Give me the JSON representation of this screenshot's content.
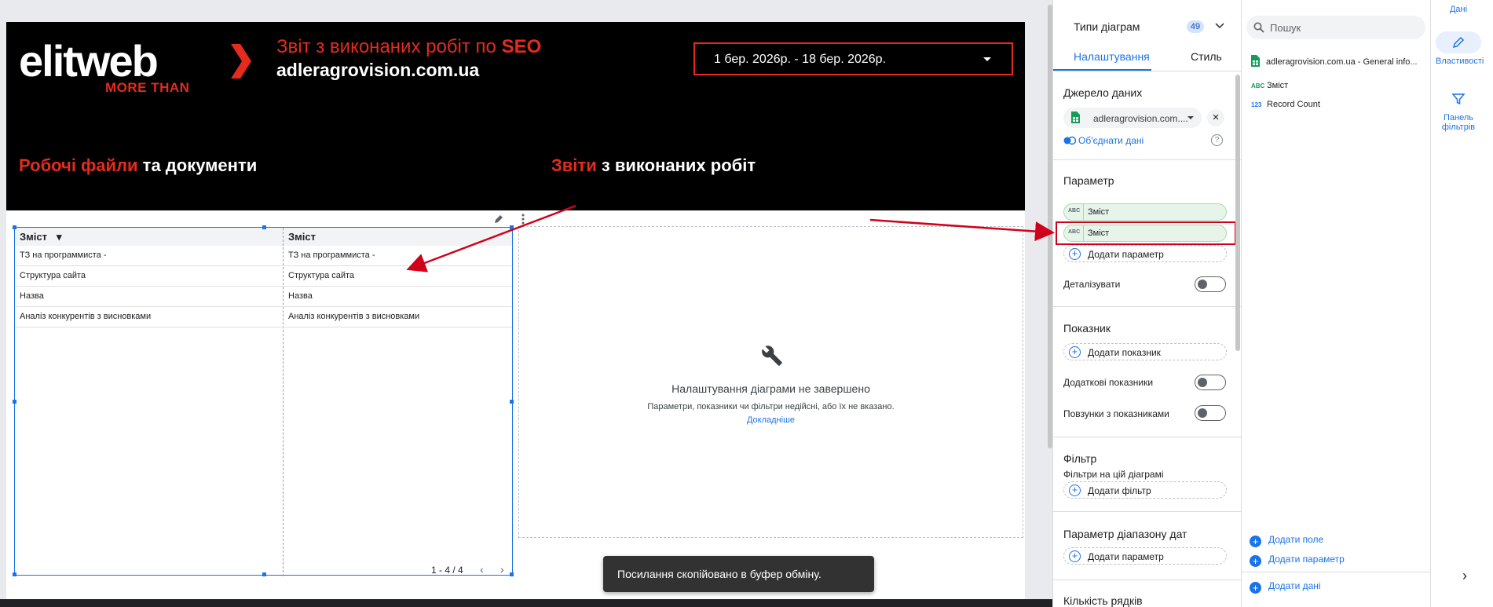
{
  "report": {
    "brand": {
      "logo_word": "elitweb",
      "tagline": "MORE THAN"
    },
    "title_prefix": "Звіт з виконаних робіт по ",
    "title_accent": "SEO",
    "domain": "adleragrovision.com.ua",
    "date_range": "1 бер. 2026р. - 18 бер. 2026р.",
    "section_left": {
      "accent": "Робочі файли",
      "rest": " та документи"
    },
    "section_right": {
      "accent": "Звіти",
      "rest": " з виконаних робіт"
    }
  },
  "table": {
    "columns": [
      "Зміст",
      "Зміст"
    ],
    "rows": [
      [
        "ТЗ на программиста -",
        "ТЗ на программиста -"
      ],
      [
        "Структура сайта",
        "Структура сайта"
      ],
      [
        "Назва",
        "Назва"
      ],
      [
        "Аналіз конкурентів з висновками",
        "Аналіз конкурентів з висновками"
      ]
    ],
    "pagination": "1 - 4 / 4"
  },
  "incomplete_chart": {
    "title": "Налаштування діаграми не завершено",
    "message": "Параметри, показники чи фільтри недійсні, або їх не вказано.",
    "link": "Докладніше"
  },
  "toast": "Посилання скопійовано в буфер обміну.",
  "properties": {
    "chart_types_label": "Типи діаграм",
    "chart_types_count": "49",
    "tab_setup": "Налаштування",
    "tab_style": "Стиль",
    "data_source_label": "Джерело даних",
    "data_source_value": "adleragrovision.com....",
    "blend_data": "Об'єднати дані",
    "dimension_label": "Параметр",
    "dimensions": [
      {
        "type": "ABC",
        "name": "Зміст"
      },
      {
        "type": "ABC",
        "name": "Зміст"
      }
    ],
    "add_dimension": "Додати параметр",
    "drill_down": "Деталізувати",
    "metric_label": "Показник",
    "add_metric": "Додати показник",
    "optional_metrics": "Додаткові показники",
    "metric_sliders": "Повзунки з показниками",
    "filter_label": "Фільтр",
    "filter_sub": "Фільтри на цій діаграмі",
    "add_filter": "Додати фільтр",
    "date_range_dim_label": "Параметр діапазону дат",
    "add_date_dim": "Додати параметр",
    "rows_label": "Кількість рядків"
  },
  "data_panel": {
    "search_placeholder": "Пошук",
    "source_name": "adleragrovision.com.ua - General info...",
    "fields": [
      {
        "type": "ABC",
        "name": "Зміст"
      },
      {
        "type": "123",
        "name": "Record Count"
      }
    ],
    "add_field": "Додати поле",
    "add_parameter": "Додати параметр",
    "add_data": "Додати дані"
  },
  "rail": {
    "data": "Дані",
    "properties": "Властивості",
    "filter_bar": "Панель фільтрів"
  },
  "colors": {
    "accent_red": "#e52b1e",
    "blue": "#1a73e8",
    "chip_green": "#e6f4ea"
  }
}
